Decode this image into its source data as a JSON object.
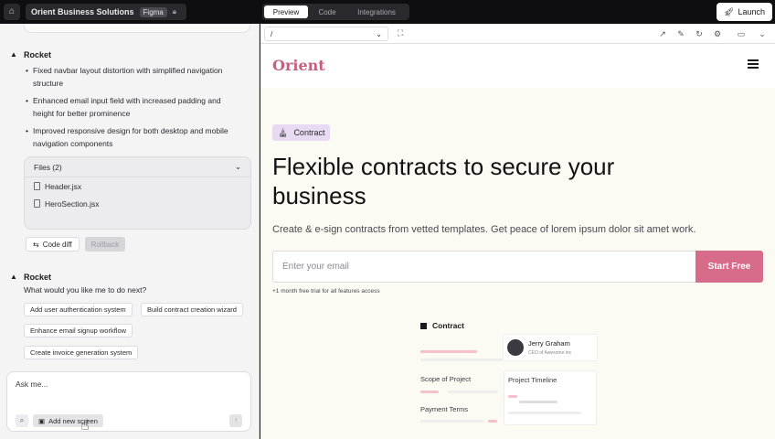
{
  "topbar": {
    "project_name": "Orient Business Solutions",
    "figma_badge": "Figma",
    "tabs": [
      {
        "label": "Preview",
        "active": true
      },
      {
        "label": "Code",
        "active": false
      },
      {
        "label": "Integrations",
        "active": false
      }
    ],
    "launch_label": "Launch"
  },
  "chat": {
    "author_1": "Rocket",
    "bullets": [
      "Fixed navbar layout distortion with simplified navigation structure",
      "Enhanced email input field with increased padding and height for better prominence",
      "Improved responsive design for both desktop and mobile navigation components"
    ],
    "files_header": "Files (2)",
    "files": [
      "Header.jsx",
      "HeroSection.jsx"
    ],
    "code_diff_label": "Code diff",
    "rollback_label": "Rollback",
    "author_2": "Rocket",
    "question": "What would you like me to do next?",
    "suggestions": [
      "Add user authentication system",
      "Build contract creation wizard",
      "Enhance email signup workflow",
      "Create invoice generation system"
    ],
    "input_placeholder": "Ask me...",
    "add_screen_label": "Add new screen"
  },
  "preview": {
    "route": "/",
    "brand": "Orient",
    "badge_label": "Contract",
    "hero_title": "Flexible contracts to secure your business",
    "hero_subtitle": "Create & e-sign contracts from vetted templates. Get peace of lorem ipsum dolor sit amet work.",
    "email_placeholder": "Enter your email",
    "cta_label": "Start Free",
    "trial_note": "+1 month free trial for all features access",
    "card": {
      "title": "Contract",
      "scope_label": "Scope of Project",
      "payment_label": "Payment Terms",
      "timeline_label": "Project Timeline",
      "person_name": "Jerry Graham",
      "person_role": "CEO of Awesome inc"
    }
  },
  "colors": {
    "brand": "#c2607e",
    "cta": "#d76b8a",
    "badge_bg": "#e8daf2",
    "topbar_bg": "#0e0e10"
  }
}
